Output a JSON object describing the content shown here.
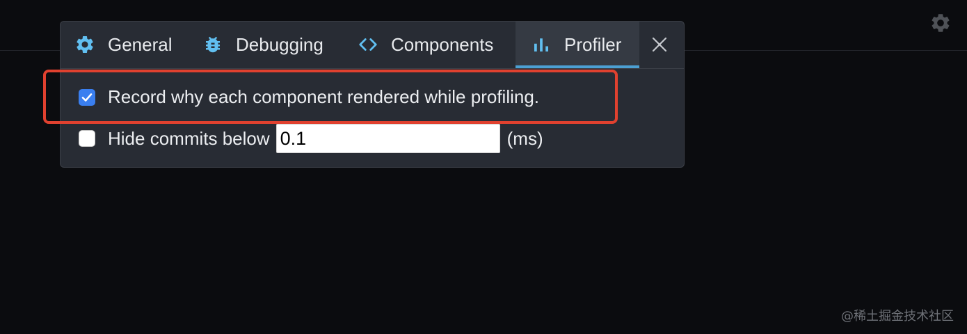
{
  "settings_button": {
    "icon": "gear-icon"
  },
  "modal": {
    "tabs": [
      {
        "label": "General",
        "icon": "gear-icon",
        "selected": false
      },
      {
        "label": "Debugging",
        "icon": "bug-icon",
        "selected": false
      },
      {
        "label": "Components",
        "icon": "code-brackets-icon",
        "selected": false
      },
      {
        "label": "Profiler",
        "icon": "bar-chart-icon",
        "selected": true
      }
    ],
    "close_icon": "close-icon",
    "options": {
      "record_why": {
        "label": "Record why each component rendered while profiling.",
        "checked": true
      },
      "hide_commits": {
        "label": "Hide commits below",
        "checked": false,
        "threshold_value": "0.1",
        "unit": "(ms)"
      }
    }
  },
  "colors": {
    "accent": "#4ca0d3",
    "checkbox_checked": "#3a7ff0",
    "highlight": "#e0412f",
    "modal_bg": "#282c34",
    "page_bg": "#0b0c0f"
  },
  "watermark": "@稀土掘金技术社区"
}
